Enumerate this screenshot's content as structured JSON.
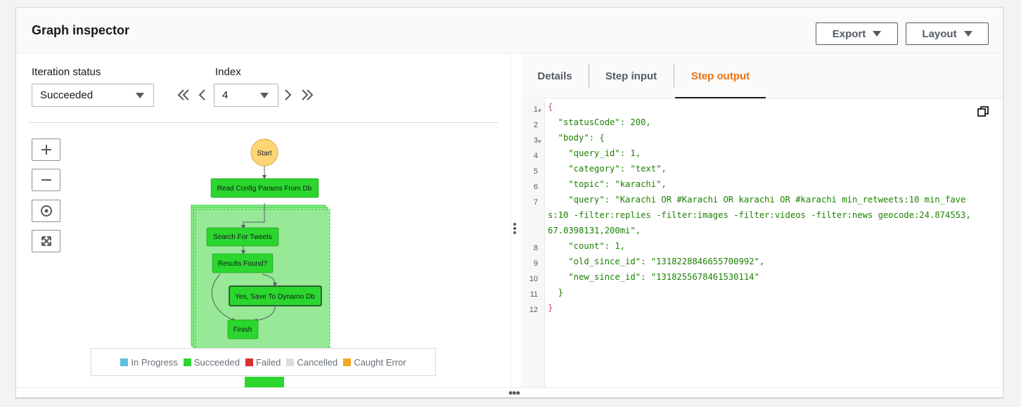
{
  "header": {
    "title": "Graph inspector",
    "export_label": "Export",
    "layout_label": "Layout"
  },
  "controls": {
    "iteration_status_label": "Iteration status",
    "iteration_status_value": "Succeeded",
    "index_label": "Index",
    "index_value": "4"
  },
  "graph": {
    "nodes": {
      "start": "Start",
      "read_config": "Read Config Params From Db",
      "search_tweets": "Search For Tweets",
      "results_found": "Results Found?",
      "save_dynamo": "Yes, Save To Dynamo Db",
      "finish": "Finish"
    }
  },
  "legend": [
    {
      "label": "In Progress",
      "color": "#5bc0de"
    },
    {
      "label": "Succeeded",
      "color": "#2bd62e"
    },
    {
      "label": "Failed",
      "color": "#d9302f"
    },
    {
      "label": "Cancelled",
      "color": "#dddddd"
    },
    {
      "label": "Caught Error",
      "color": "#f6a623"
    }
  ],
  "tabs": [
    {
      "label": "Details",
      "active": false
    },
    {
      "label": "Step input",
      "active": false
    },
    {
      "label": "Step output",
      "active": true
    }
  ],
  "editor": {
    "line_numbers": [
      "1",
      "2",
      "3",
      "4",
      "5",
      "6",
      "7",
      "",
      "8",
      "9",
      "10",
      "11",
      "12"
    ],
    "lines": [
      "{",
      "  \"statusCode\": 200,",
      "  \"body\": {",
      "    \"query_id\": 1,",
      "    \"category\": \"text\",",
      "    \"topic\": \"karachi\",",
      "    \"query\": \"Karachi OR #Karachi OR karachi OR #karachi min_retweets:10 min_fave",
      "s:10 -filter:replies -filter:images -filter:videos -filter:news geocode:24.874553,",
      "67.0398131,200mi\",",
      "    \"count\": 1,",
      "    \"old_since_id\": \"1318228846655700992\",",
      "    \"new_since_id\": \"1318255678461530114\"",
      "  }",
      "}"
    ]
  }
}
